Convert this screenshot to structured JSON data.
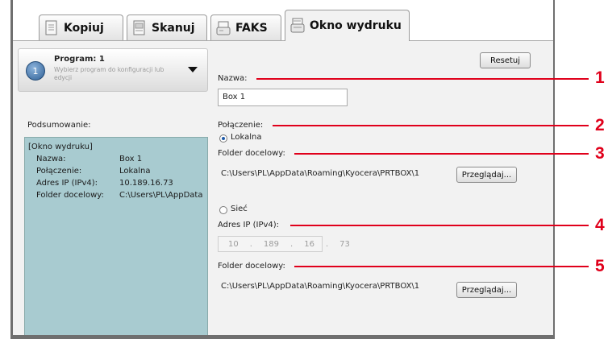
{
  "tabs": [
    {
      "label": "Kopiuj",
      "icon": "copy-icon",
      "active": false
    },
    {
      "label": "Skanuj",
      "icon": "scan-icon",
      "active": false
    },
    {
      "label": "FAKS",
      "icon": "fax-icon",
      "active": false
    },
    {
      "label": "Okno wydruku",
      "icon": "print-box-icon",
      "active": true
    }
  ],
  "program": {
    "number": "1",
    "title": "Program: 1",
    "description": "Wybierz program do konfiguracji lub edycji"
  },
  "reset_label": "Resetuj",
  "summary": {
    "label": "Podsumowanie:",
    "header": "[Okno wydruku]",
    "rows": [
      {
        "key": "Nazwa:",
        "value": "Box 1"
      },
      {
        "key": "Połączenie:",
        "value": "Lokalna"
      },
      {
        "key": "Adres IP (IPv4):",
        "value": "10.189.16.73"
      },
      {
        "key": "Folder docelowy:",
        "value": "C:\\Users\\PL\\AppData"
      }
    ]
  },
  "form": {
    "name_label": "Nazwa:",
    "name_value": "Box 1",
    "connection_label": "Połączenie:",
    "local_label": "Lokalna",
    "local_folder_label": "Folder docelowy:",
    "local_folder_path": "C:\\Users\\PL\\AppData\\Roaming\\Kyocera\\PRTBOX\\1",
    "browse_label": "Przeglądaj...",
    "network_label": "Sieć",
    "ip_label": "Adres IP (IPv4):",
    "ip_octets": [
      "10",
      "189",
      "16",
      "73"
    ],
    "ip_separator": ".",
    "network_folder_label": "Folder docelowy:",
    "network_folder_path": "C:\\Users\\PL\\AppData\\Roaming\\Kyocera\\PRTBOX\\1"
  },
  "callouts": [
    "1",
    "2",
    "3",
    "4",
    "5"
  ],
  "colors": {
    "callout": "#e0001b",
    "summary_bg": "#a8cbd0",
    "panel_bg": "#f2f2f2"
  }
}
